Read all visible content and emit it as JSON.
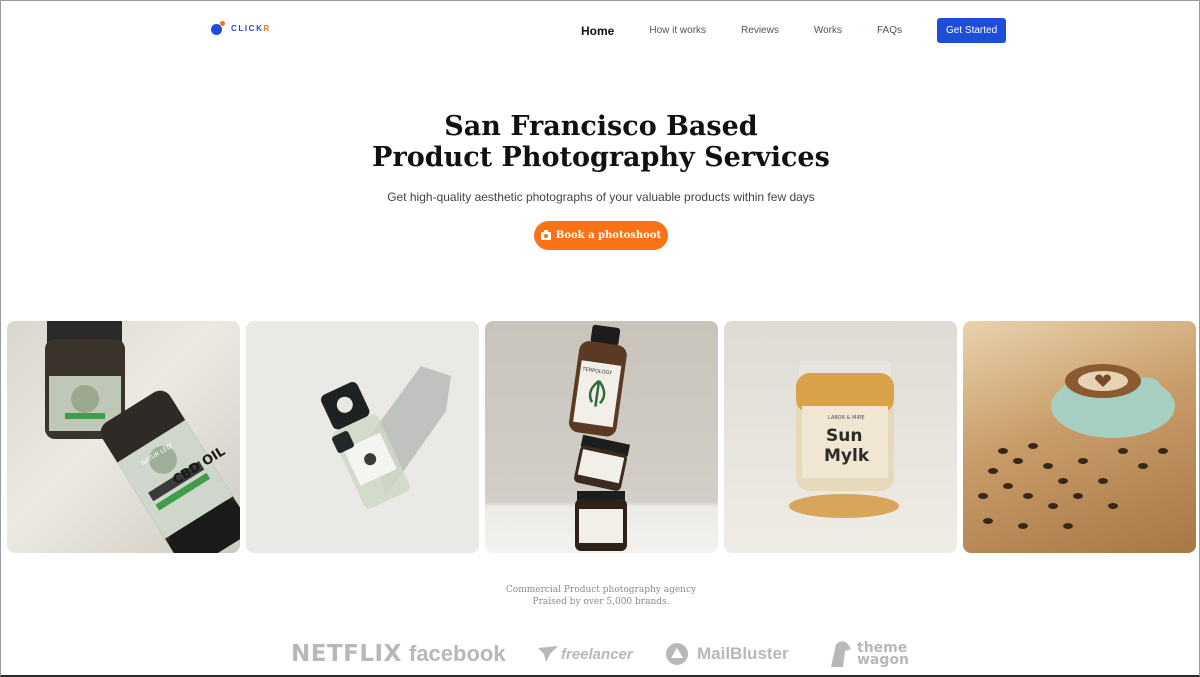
{
  "logo": {
    "text": "CLICK",
    "accent": "R"
  },
  "nav": {
    "home": "Home",
    "how": "How it works",
    "reviews": "Reviews",
    "works": "Works",
    "faqs": "FAQs",
    "cta": "Get Started"
  },
  "hero": {
    "title_line1": "San Francisco Based",
    "title_line2": "Product Photography Services",
    "subtitle": "Get high-quality aesthetic photographs of your valuable products within few days",
    "book_button": "Book a photoshoot"
  },
  "gallery": {
    "photo1": {
      "label1": "CBD OIL",
      "label2": "NATUR LEEF"
    },
    "photo3": {
      "label": "TERPOLOGY"
    },
    "photo4": {
      "line1": "Sun",
      "line2": "Mylk",
      "brand": "LABOR & MIRE"
    }
  },
  "praise": {
    "line1": "Commercial Product photography agency",
    "line2": "Praised by over 5,000 brands."
  },
  "brands": {
    "netflix": "NETFLIX",
    "facebook": "facebook",
    "freelancer": "freelancer",
    "mailbluster": "MailBluster",
    "themewagon_1": "theme",
    "themewagon_2": "wagon"
  },
  "colors": {
    "primary": "#1d4ed8",
    "accent": "#f97316",
    "brand_gray": "#b8b8b8"
  }
}
